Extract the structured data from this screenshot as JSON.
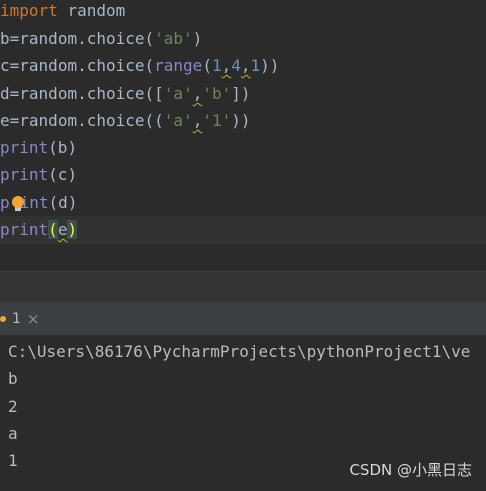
{
  "editor": {
    "line1": {
      "keyword": "import",
      "module": "random"
    },
    "line2": {
      "var": "b",
      "eq": "=",
      "call": "random.choice(",
      "str": "'ab'",
      "close": ")"
    },
    "line3": {
      "var": "c",
      "eq": "=",
      "call": "random.choice(",
      "fn": "range",
      "open": "(",
      "n1": "1",
      "comma1": ",",
      "n2": "4",
      "comma2": ",",
      "n3": "1",
      "close": "))"
    },
    "line4": {
      "var": "d",
      "eq": "=",
      "call": "random.choice([",
      "s1": "'a'",
      "comma": ",",
      "s2": "'b'",
      "close": "])"
    },
    "line5": {
      "var": "e",
      "eq": "=",
      "call": "random.choice((",
      "s1": "'a'",
      "comma": ",",
      "s2": "'1'",
      "close": "))"
    },
    "line6": {
      "fn": "print",
      "args": "(b)"
    },
    "line7": {
      "fn": "print",
      "args": "(c)"
    },
    "line8": {
      "fn_start": "p",
      "fn_end": "int",
      "args": "(d)"
    },
    "line9": {
      "fn": "print",
      "open": "(",
      "arg": "e",
      "close": ")"
    }
  },
  "run_panel": {
    "tab_label": "1",
    "close_glyph": "×"
  },
  "console": {
    "command": "C:\\Users\\86176\\PycharmProjects\\pythonProject1\\ve",
    "output": [
      "b",
      "2",
      "a",
      "1"
    ]
  },
  "watermark": "CSDN @小黑日志",
  "icons": {
    "intention_bulb": "lightbulb-icon",
    "tab_close": "close-icon"
  },
  "colors": {
    "keyword": "#cc7832",
    "string": "#6a8759",
    "number": "#6897bb",
    "builtin": "#8888c6",
    "text": "#a9b7c6",
    "background": "#2b2b2b"
  }
}
